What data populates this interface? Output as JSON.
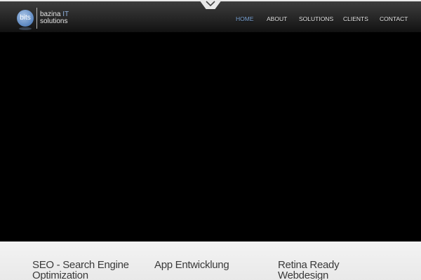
{
  "header": {
    "logo_badge": "bits",
    "logo_name": "bazina",
    "logo_accent": "IT",
    "logo_subline": "solutions",
    "dropdown_icon": "chevron-down-icon"
  },
  "nav": {
    "active": "HOME",
    "items": [
      "HOME",
      "ABOUT",
      "SOLUTIONS",
      "CLIENTS",
      "CONTACT"
    ]
  },
  "services": {
    "items": [
      {
        "title": "SEO - Search Engine Optimization"
      },
      {
        "title": "App Entwicklung"
      },
      {
        "title": "Retina Ready Webdesign"
      }
    ]
  },
  "colors": {
    "accent": "#7fa7d8",
    "header_top": "#3d3d3d",
    "header_bottom": "#111111",
    "hero_bg": "#000000",
    "services_bg": "#f0f0f0"
  }
}
